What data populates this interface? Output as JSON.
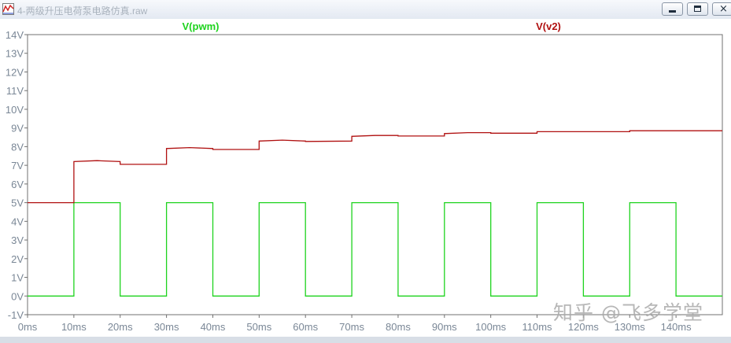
{
  "window": {
    "title": "4-两级升压电荷泵电路仿真.raw"
  },
  "watermark": "知乎 @飞多学堂",
  "colors": {
    "pwm": "#1ed31e",
    "v2": "#b01010",
    "axis": "#707070",
    "tick_label": "#7a8796",
    "background": "#ffffff"
  },
  "chart_data": {
    "type": "line",
    "x_unit": "ms",
    "y_unit": "V",
    "xlim": [
      0,
      150
    ],
    "ylim": [
      -1,
      14
    ],
    "x_ticks": [
      "0ms",
      "10ms",
      "20ms",
      "30ms",
      "40ms",
      "50ms",
      "60ms",
      "70ms",
      "80ms",
      "90ms",
      "100ms",
      "110ms",
      "120ms",
      "130ms",
      "140ms"
    ],
    "y_ticks": [
      "14V",
      "13V",
      "12V",
      "11V",
      "10V",
      "9V",
      "8V",
      "7V",
      "6V",
      "5V",
      "4V",
      "3V",
      "2V",
      "1V",
      "0V",
      "-1V"
    ],
    "grid": false,
    "series": [
      {
        "name": "V(pwm)",
        "color": "#1ed31e",
        "points": [
          [
            0,
            0
          ],
          [
            10,
            0
          ],
          [
            10,
            5
          ],
          [
            20,
            5
          ],
          [
            20,
            0
          ],
          [
            30,
            0
          ],
          [
            30,
            5
          ],
          [
            40,
            5
          ],
          [
            40,
            0
          ],
          [
            50,
            0
          ],
          [
            50,
            5
          ],
          [
            60,
            5
          ],
          [
            60,
            0
          ],
          [
            70,
            0
          ],
          [
            70,
            5
          ],
          [
            80,
            5
          ],
          [
            80,
            0
          ],
          [
            90,
            0
          ],
          [
            90,
            5
          ],
          [
            100,
            5
          ],
          [
            100,
            0
          ],
          [
            110,
            0
          ],
          [
            110,
            5
          ],
          [
            120,
            5
          ],
          [
            120,
            0
          ],
          [
            130,
            0
          ],
          [
            130,
            5
          ],
          [
            140,
            5
          ],
          [
            140,
            0
          ],
          [
            150,
            0
          ]
        ]
      },
      {
        "name": "V(v2)",
        "color": "#b01010",
        "points": [
          [
            0,
            5
          ],
          [
            10,
            5
          ],
          [
            10,
            7.2
          ],
          [
            15,
            7.25
          ],
          [
            20,
            7.2
          ],
          [
            20,
            7.05
          ],
          [
            30,
            7.05
          ],
          [
            30,
            7.9
          ],
          [
            35,
            7.95
          ],
          [
            40,
            7.9
          ],
          [
            40,
            7.85
          ],
          [
            50,
            7.85
          ],
          [
            50,
            8.3
          ],
          [
            55,
            8.35
          ],
          [
            60,
            8.3
          ],
          [
            60,
            8.28
          ],
          [
            70,
            8.3
          ],
          [
            70,
            8.55
          ],
          [
            75,
            8.6
          ],
          [
            80,
            8.6
          ],
          [
            80,
            8.57
          ],
          [
            90,
            8.57
          ],
          [
            90,
            8.7
          ],
          [
            95,
            8.75
          ],
          [
            100,
            8.75
          ],
          [
            100,
            8.72
          ],
          [
            110,
            8.72
          ],
          [
            110,
            8.8
          ],
          [
            120,
            8.8
          ],
          [
            130,
            8.8
          ],
          [
            130,
            8.85
          ],
          [
            150,
            8.85
          ]
        ]
      }
    ]
  }
}
